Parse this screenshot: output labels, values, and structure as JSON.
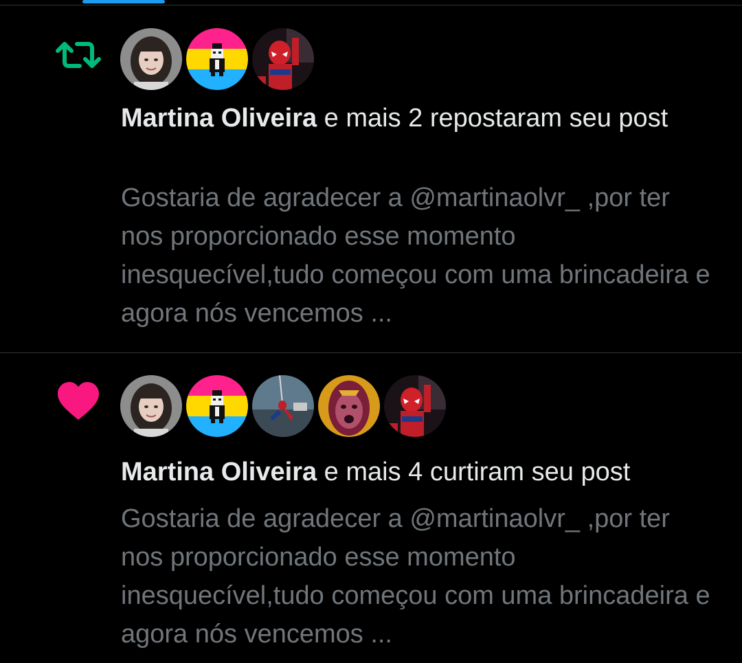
{
  "colors": {
    "background": "#000000",
    "primary_text": "#e7e9ea",
    "secondary_text": "#71767b",
    "repost_green": "#00ba7c",
    "like_pink": "#f91880",
    "accent_blue": "#1d9bf0"
  },
  "notifications": [
    {
      "type": "repost",
      "icon": "repost-icon",
      "avatars": [
        "avatar-martina",
        "avatar-pansexual-flag",
        "avatar-spiderman"
      ],
      "actor_name": "Martina Oliveira",
      "action_text": " e mais 2 repostaram seu post",
      "post_preview": "Gostaria de agradecer a @martinaolvr_ ,por ter nos proporcionado esse momento inesquecível,tudo começou com uma brincadeira e agora nós vencemos ..."
    },
    {
      "type": "like",
      "icon": "heart-icon",
      "avatars": [
        "avatar-martina",
        "avatar-pansexual-flag",
        "avatar-spiderman-swing",
        "avatar-vision",
        "avatar-spiderman"
      ],
      "actor_name": "Martina Oliveira",
      "action_text": " e mais 4 curtiram seu post",
      "post_preview": "Gostaria de agradecer a @martinaolvr_ ,por ter nos proporcionado esse momento inesquecível,tudo começou com uma brincadeira e agora nós vencemos ..."
    }
  ]
}
